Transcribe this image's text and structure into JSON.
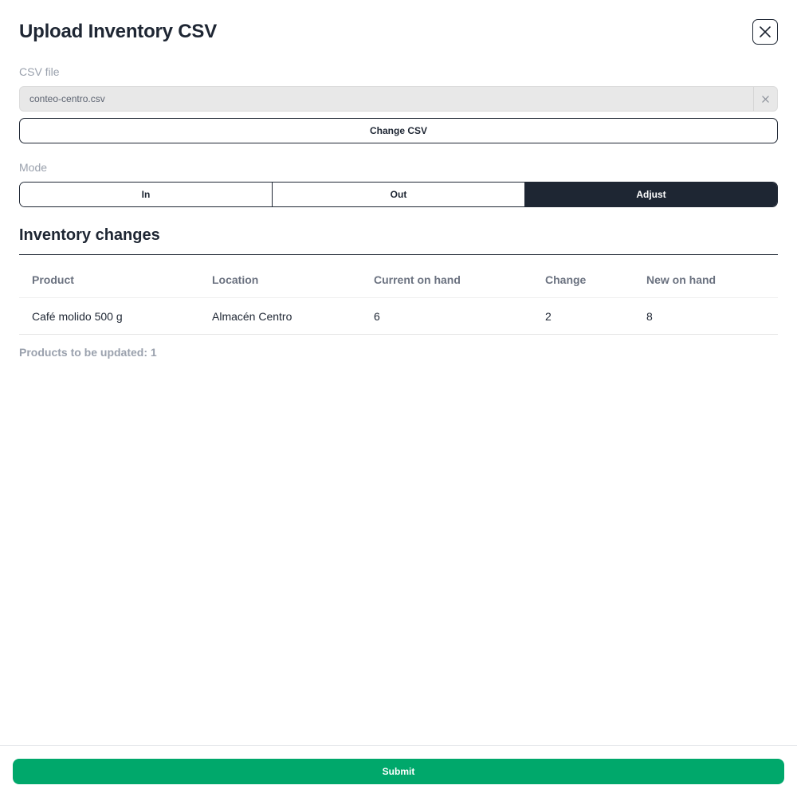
{
  "dialog": {
    "title": "Upload Inventory CSV",
    "close_icon": "close-icon"
  },
  "csv": {
    "label": "CSV file",
    "file_name": "conteo-centro.csv",
    "clear_icon": "close-icon",
    "change_label": "Change CSV"
  },
  "mode": {
    "label": "Mode",
    "options": [
      "In",
      "Out",
      "Adjust"
    ],
    "selected": "Adjust"
  },
  "changes": {
    "title": "Inventory changes",
    "columns": [
      "Product",
      "Location",
      "Current on hand",
      "Change",
      "New on hand"
    ],
    "rows": [
      [
        "Café molido 500 g",
        "Almacén Centro",
        "6",
        "2",
        "8"
      ]
    ],
    "summary": "Products to be updated: 1"
  },
  "footer": {
    "submit_label": "Submit",
    "submit_color": "#00a86b"
  },
  "colors": {
    "dark": "#1e2633",
    "muted": "#9aa1ad"
  }
}
